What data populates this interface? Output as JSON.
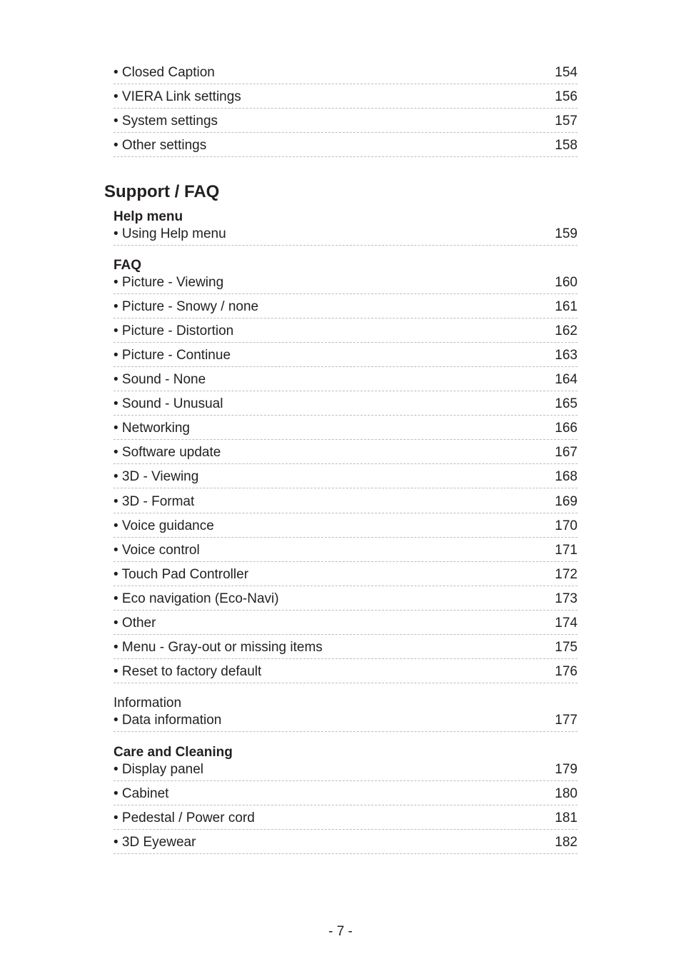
{
  "top_entries": [
    {
      "label": "• Closed Caption",
      "page": "154"
    },
    {
      "label": "• VIERA Link settings",
      "page": "156"
    },
    {
      "label": "• System settings",
      "page": "157"
    },
    {
      "label": "• Other settings",
      "page": "158"
    }
  ],
  "section": {
    "title": "Support / FAQ",
    "groups": [
      {
        "title": "Help menu",
        "bold": true,
        "entries": [
          {
            "label": "• Using Help menu",
            "page": "159"
          }
        ]
      },
      {
        "title": "FAQ",
        "bold": true,
        "entries": [
          {
            "label": "• Picture - Viewing",
            "page": "160"
          },
          {
            "label": "• Picture - Snowy / none",
            "page": "161"
          },
          {
            "label": "• Picture - Distortion",
            "page": "162"
          },
          {
            "label": "• Picture - Continue",
            "page": "163"
          },
          {
            "label": "• Sound - None",
            "page": "164"
          },
          {
            "label": "• Sound - Unusual",
            "page": "165"
          },
          {
            "label": "• Networking",
            "page": "166"
          },
          {
            "label": "• Software update",
            "page": "167"
          },
          {
            "label": "• 3D - Viewing",
            "page": "168"
          },
          {
            "label": "• 3D - Format",
            "page": "169"
          },
          {
            "label": "• Voice guidance",
            "page": "170"
          },
          {
            "label": "• Voice control",
            "page": "171"
          },
          {
            "label": "• Touch Pad Controller",
            "page": "172"
          },
          {
            "label": "• Eco navigation (Eco-Navi)",
            "page": "173"
          },
          {
            "label": "• Other",
            "page": "174"
          },
          {
            "label": "• Menu - Gray-out or missing items",
            "page": "175"
          },
          {
            "label": "• Reset to factory default",
            "page": "176"
          }
        ]
      },
      {
        "title": "Information",
        "bold": false,
        "entries": [
          {
            "label": "• Data information",
            "page": "177"
          }
        ]
      },
      {
        "title": "Care and Cleaning",
        "bold": true,
        "entries": [
          {
            "label": "• Display panel",
            "page": "179"
          },
          {
            "label": "• Cabinet",
            "page": "180"
          },
          {
            "label": "• Pedestal / Power cord",
            "page": "181"
          },
          {
            "label": "• 3D Eyewear",
            "page": "182"
          }
        ]
      }
    ]
  },
  "footer": {
    "page_number": "- 7 -"
  }
}
